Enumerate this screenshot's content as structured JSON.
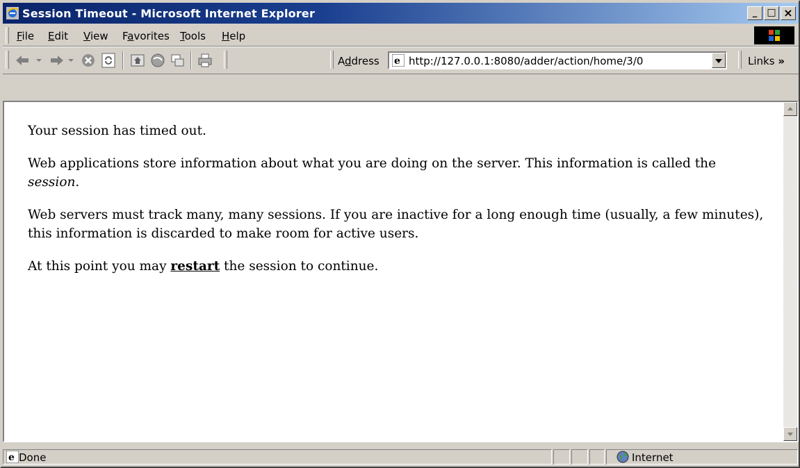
{
  "window": {
    "title": "Session Timeout - Microsoft Internet Explorer",
    "min_glyph": "_",
    "max_glyph": "□",
    "close_glyph": "×"
  },
  "menu": {
    "items": [
      {
        "pre": "",
        "key": "F",
        "post": "ile"
      },
      {
        "pre": "",
        "key": "E",
        "post": "dit"
      },
      {
        "pre": "",
        "key": "V",
        "post": "iew"
      },
      {
        "pre": "F",
        "key": "a",
        "post": "vorites"
      },
      {
        "pre": "",
        "key": "T",
        "post": "ools"
      },
      {
        "pre": "",
        "key": "H",
        "post": "elp"
      }
    ]
  },
  "toolbar": {
    "address_pre": "A",
    "address_key": "d",
    "address_post": "dress",
    "url": "http://127.0.0.1:8080/adder/action/home/3/0",
    "links_label": "Links",
    "links_chevron": "»",
    "icons": [
      "back-arrow-icon",
      "forward-arrow-icon",
      "stop-icon",
      "refresh-icon",
      "home-icon",
      "search-icon",
      "favorites-icon",
      "history-icon",
      "print-icon"
    ]
  },
  "page": {
    "p1": "Your session has timed out.",
    "p2_a": "Web applications store information about what you are doing on the server. This information is called the ",
    "p2_em": "session",
    "p2_b": ".",
    "p3": "Web servers must track many, many sessions. If you are inactive for a long enough time (usually, a few minutes), this information is discarded to make room for active users.",
    "p4_a": "At this point you may ",
    "p4_link": "restart",
    "p4_b": " the session to continue."
  },
  "status": {
    "text": "Done",
    "zone": "Internet"
  },
  "colors": {
    "titlebar_start": "#0a246a",
    "titlebar_end": "#a6caf0",
    "chrome": "#d4d0c8"
  }
}
